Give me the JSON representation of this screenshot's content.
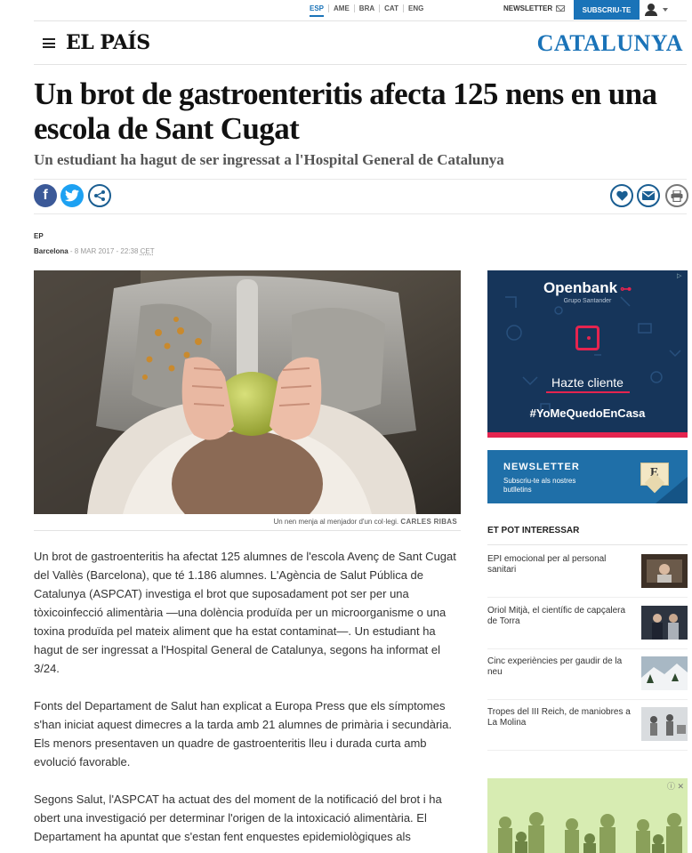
{
  "topbar": {
    "editions": [
      "ESP",
      "AME",
      "BRA",
      "CAT",
      "ENG"
    ],
    "newsletter_label": "NEWSLETTER",
    "subscribe_label": "SUBSCRIU-TE"
  },
  "header": {
    "logo": "EL PAÍS",
    "section": "CATALUNYA"
  },
  "article": {
    "headline": "Un brot de gastroenteritis afecta 125 nens en una escola de Sant Cugat",
    "subheadline": "Un estudiant ha hagut de ser ingressat a l'Hospital General de Catalunya",
    "author": "EP",
    "location": "Barcelona",
    "date": "8 MAR 2017 - 22:38",
    "timezone": "CET",
    "photo_caption": "Un nen menja al menjador d'un col·legi.",
    "photo_credit": "CARLES RIBAS",
    "paragraphs": [
      "Un brot de gastroenteritis ha afectat 125 alumnes de l'escola Avenç de Sant Cugat del Vallès (Barcelona), que té 1.186 alumnes. L'Agència de Salut Pública de Catalunya (ASPCAT) investiga el brot que suposadament pot ser per una tòxicoinfecció alimentària —una dolència produïda per un microorganisme o una toxina produïda pel mateix aliment que ha estat contaminat—. Un estudiant ha hagut de ser ingressat a l'Hospital General de Catalunya, segons ha informat el 3/24.",
      "Fonts del Departament de Salut han explicat a Europa Press que els símptomes s'han iniciat aquest dimecres a la tarda amb 21 alumnes de primària i secundària. Els menors presentaven un quadre de gastroenteritis lleu i durada curta amb evolució favorable.",
      "Segons Salut, l'ASPCAT ha actuat des del moment de la notificació del brot i ha obert una investigació per determinar l'origen de la intoxicació alimentària. El Departament ha apuntat que s'estan fent enquestes epidemiològiques als"
    ]
  },
  "share": {
    "facebook_icon": "f"
  },
  "sidebar": {
    "ad": {
      "brand": "Openbank",
      "brand_sub": "Grupo Santander",
      "cta": "Hazte cliente",
      "hashtag": "#YoMeQuedoEnCasa"
    },
    "newsletter": {
      "title": "NEWSLETTER",
      "subtitle": "Subscriu-te als nostres butlletins"
    },
    "related_title": "ET POT INTERESSAR",
    "related": [
      {
        "title": "EPI emocional per al personal sanitari"
      },
      {
        "title": "Oriol Mitjà, el científic de capçalera de Torra"
      },
      {
        "title": "Cinc experiències per gaudir de la neu"
      },
      {
        "title": "Tropes del III Reich, de maniobres a La Molina"
      }
    ]
  },
  "colors": {
    "accent": "#1a73b8",
    "facebook": "#3b5998",
    "twitter": "#1da1f2",
    "ad_bg": "#16355a",
    "ad_accent": "#e5244f"
  }
}
